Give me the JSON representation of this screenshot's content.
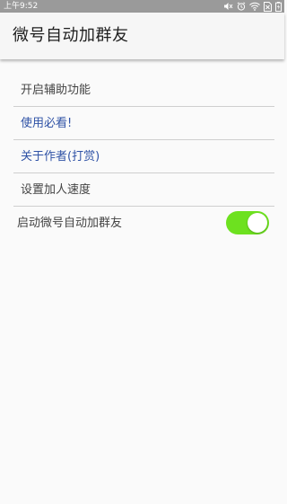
{
  "status_bar": {
    "time": "上午9:52",
    "icons": [
      "mute-icon",
      "alarm-icon",
      "wifi-icon",
      "sim-none-icon",
      "battery-charging-icon"
    ]
  },
  "app_bar": {
    "title": "微号自动加群友"
  },
  "menu": {
    "items": [
      {
        "label": "开启辅助功能"
      },
      {
        "label": "使用必看!"
      },
      {
        "label": "关于作者(打赏)"
      },
      {
        "label": "设置加人速度"
      }
    ]
  },
  "toggle": {
    "label": "启动微号自动加群友",
    "state": "on",
    "color": "#6de11f"
  },
  "colors": {
    "status_bar": "#9a9a9a",
    "app_bar": "#f6f6f6",
    "background": "#fafafa",
    "link": "#2f52a6",
    "text": "#444444"
  }
}
